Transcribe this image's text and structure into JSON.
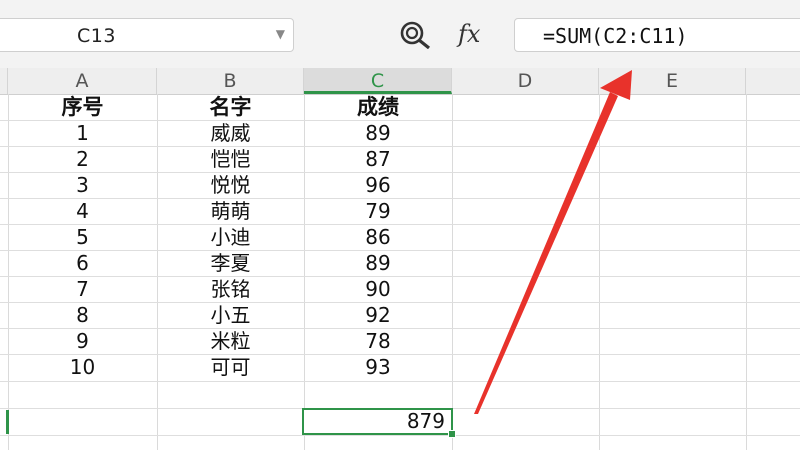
{
  "formula_bar": {
    "name_box": "C13",
    "formula": "=SUM(C2:C11)",
    "fx_label": "fx"
  },
  "columns": [
    "A",
    "B",
    "C",
    "D",
    "E"
  ],
  "table": {
    "headers": [
      "序号",
      "名字",
      "成绩"
    ],
    "rows": [
      [
        "1",
        "威威",
        "89"
      ],
      [
        "2",
        "恺恺",
        "87"
      ],
      [
        "3",
        "悦悦",
        "96"
      ],
      [
        "4",
        "萌萌",
        "79"
      ],
      [
        "5",
        "小迪",
        "86"
      ],
      [
        "6",
        "李夏",
        "89"
      ],
      [
        "7",
        "张铭",
        "90"
      ],
      [
        "8",
        "小五",
        "92"
      ],
      [
        "9",
        "米粒",
        "78"
      ],
      [
        "10",
        "可可",
        "93"
      ]
    ],
    "total": "879"
  },
  "colors": {
    "accent": "#2f9449",
    "arrow": "#e8322b"
  },
  "icons": {
    "zoom": "zoom-icon",
    "fx": "function-icon",
    "caret": "chevron-down-icon"
  }
}
